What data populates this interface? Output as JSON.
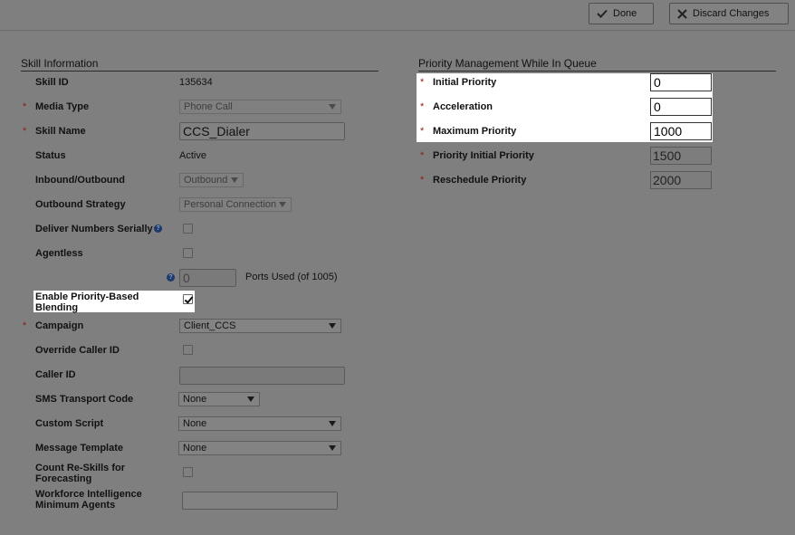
{
  "toolbar": {
    "done_label": "Done",
    "discard_label": "Discard Changes"
  },
  "skill": {
    "section_title": "Skill Information",
    "skill_id_label": "Skill ID",
    "skill_id_value": "135634",
    "media_type_label": "Media Type",
    "media_type_value": "Phone Call",
    "skill_name_label": "Skill Name",
    "skill_name_value": "CCS_Dialer",
    "status_label": "Status",
    "status_value": "Active",
    "inout_label": "Inbound/Outbound",
    "inout_value": "Outbound",
    "strategy_label": "Outbound Strategy",
    "strategy_value": "Personal Connection",
    "deliver_serially_label": "Deliver Numbers Serially",
    "agentless_label": "Agentless",
    "ports_value": "0",
    "ports_suffix": "Ports Used (of 1005)",
    "blending_label": "Enable Priority-Based Blending",
    "campaign_label": "Campaign",
    "campaign_value": "Client_CCS",
    "override_caller_id_label": "Override Caller ID",
    "caller_id_label": "Caller ID",
    "caller_id_value": "",
    "sms_label": "SMS Transport Code",
    "sms_value": "None",
    "custom_script_label": "Custom Script",
    "custom_script_value": "None",
    "message_template_label": "Message Template",
    "message_template_value": "None",
    "count_reskills_label": "Count Re-Skills for Forecasting",
    "wfi_label": "Workforce Intelligence Minimum Agents",
    "wfi_value": "",
    "required_mark": "*",
    "help_glyph": "?"
  },
  "priority": {
    "section_title": "Priority Management While In Queue",
    "initial_label": "Initial Priority",
    "initial_value": "0",
    "acceleration_label": "Acceleration",
    "acceleration_value": "0",
    "max_label": "Maximum Priority",
    "max_value": "1000",
    "pip_label": "Priority Initial Priority",
    "pip_value": "1500",
    "reschedule_label": "Reschedule Priority",
    "reschedule_value": "2000"
  },
  "checkboxes": {
    "deliver_serially": false,
    "agentless": false,
    "blending": true,
    "override_caller_id": false,
    "count_reskills": false
  },
  "icons": {
    "done": "check-icon",
    "discard": "x-icon",
    "help": "help-icon",
    "dropdown": "chevron-down-icon"
  },
  "colors": {
    "overlay": "#7f7f7f",
    "highlight": "#ffffff",
    "required": "#8b1a1a",
    "help": "#1d3a6a"
  }
}
